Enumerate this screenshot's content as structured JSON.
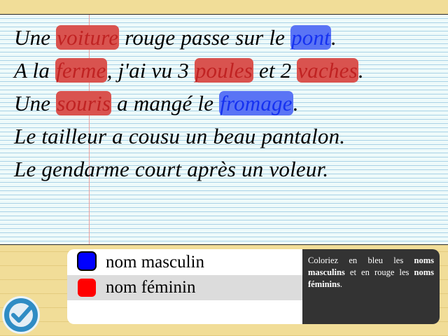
{
  "sentences": [
    [
      {
        "t": "Une "
      },
      {
        "t": "voiture",
        "g": "fem"
      },
      {
        "t": " rouge passe sur le "
      },
      {
        "t": "pont",
        "g": "masc"
      },
      {
        "t": "."
      }
    ],
    [
      {
        "t": "A la "
      },
      {
        "t": "ferme",
        "g": "fem"
      },
      {
        "t": ", j'ai vu 3 "
      },
      {
        "t": "poules",
        "g": "fem"
      },
      {
        "t": " et 2 "
      },
      {
        "t": "vaches",
        "g": "fem"
      },
      {
        "t": "."
      }
    ],
    [
      {
        "t": "Une "
      },
      {
        "t": "souris",
        "g": "fem"
      },
      {
        "t": " a mangé le "
      },
      {
        "t": "fromage",
        "g": "masc"
      },
      {
        "t": "."
      }
    ],
    [
      {
        "t": "Le tailleur a cousu un beau pantalon."
      }
    ],
    [
      {
        "t": "Le gendarme court après un voleur."
      }
    ]
  ],
  "legend": {
    "masculine": {
      "label": "nom masculin",
      "color": "#0000ff"
    },
    "feminine": {
      "label": "nom féminin",
      "color": "#ff0000"
    }
  },
  "instruction": {
    "part1": "Coloriez en bleu les ",
    "bold1": "noms masculins",
    "part2": " et en rouge les ",
    "bold2": "noms féminins",
    "part3": "."
  },
  "check_button": {
    "icon": "checkmark-icon"
  }
}
